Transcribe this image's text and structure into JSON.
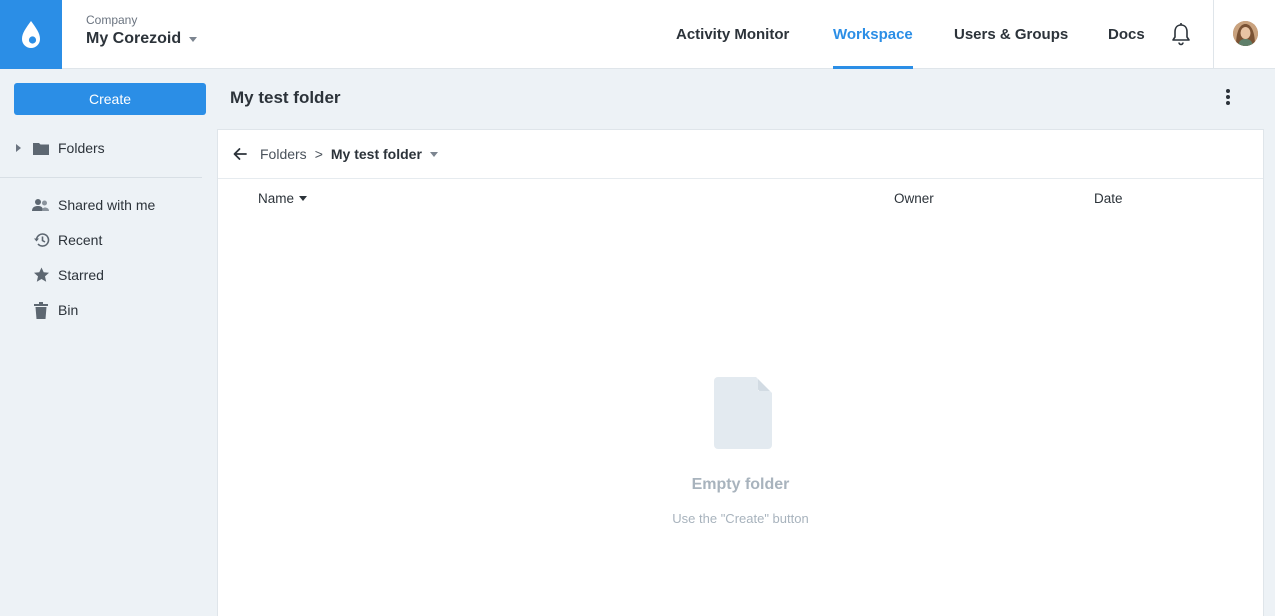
{
  "header": {
    "company_label": "Company",
    "company_name": "My Corezoid",
    "nav": [
      {
        "label": "Activity Monitor",
        "active": false
      },
      {
        "label": "Workspace",
        "active": true
      },
      {
        "label": "Users & Groups",
        "active": false
      },
      {
        "label": "Docs",
        "active": false
      }
    ],
    "icons": [
      "logo-drop-icon",
      "bell-icon",
      "avatar"
    ]
  },
  "sidebar": {
    "create_label": "Create",
    "folders_label": "Folders",
    "items": [
      {
        "label": "Shared with me",
        "icon": "users-icon"
      },
      {
        "label": "Recent",
        "icon": "history-icon"
      },
      {
        "label": "Starred",
        "icon": "star-icon"
      },
      {
        "label": "Bin",
        "icon": "trash-icon"
      }
    ]
  },
  "main": {
    "title": "My test folder",
    "breadcrumb": {
      "root": "Folders",
      "separator": ">",
      "current": "My test folder"
    },
    "columns": {
      "name": "Name",
      "owner": "Owner",
      "date": "Date"
    },
    "empty": {
      "title": "Empty folder",
      "subtitle": "Use the \"Create\" button"
    }
  },
  "colors": {
    "accent": "#2b8ee6",
    "background": "#edf2f6",
    "muted_text": "#a8b3bd"
  }
}
